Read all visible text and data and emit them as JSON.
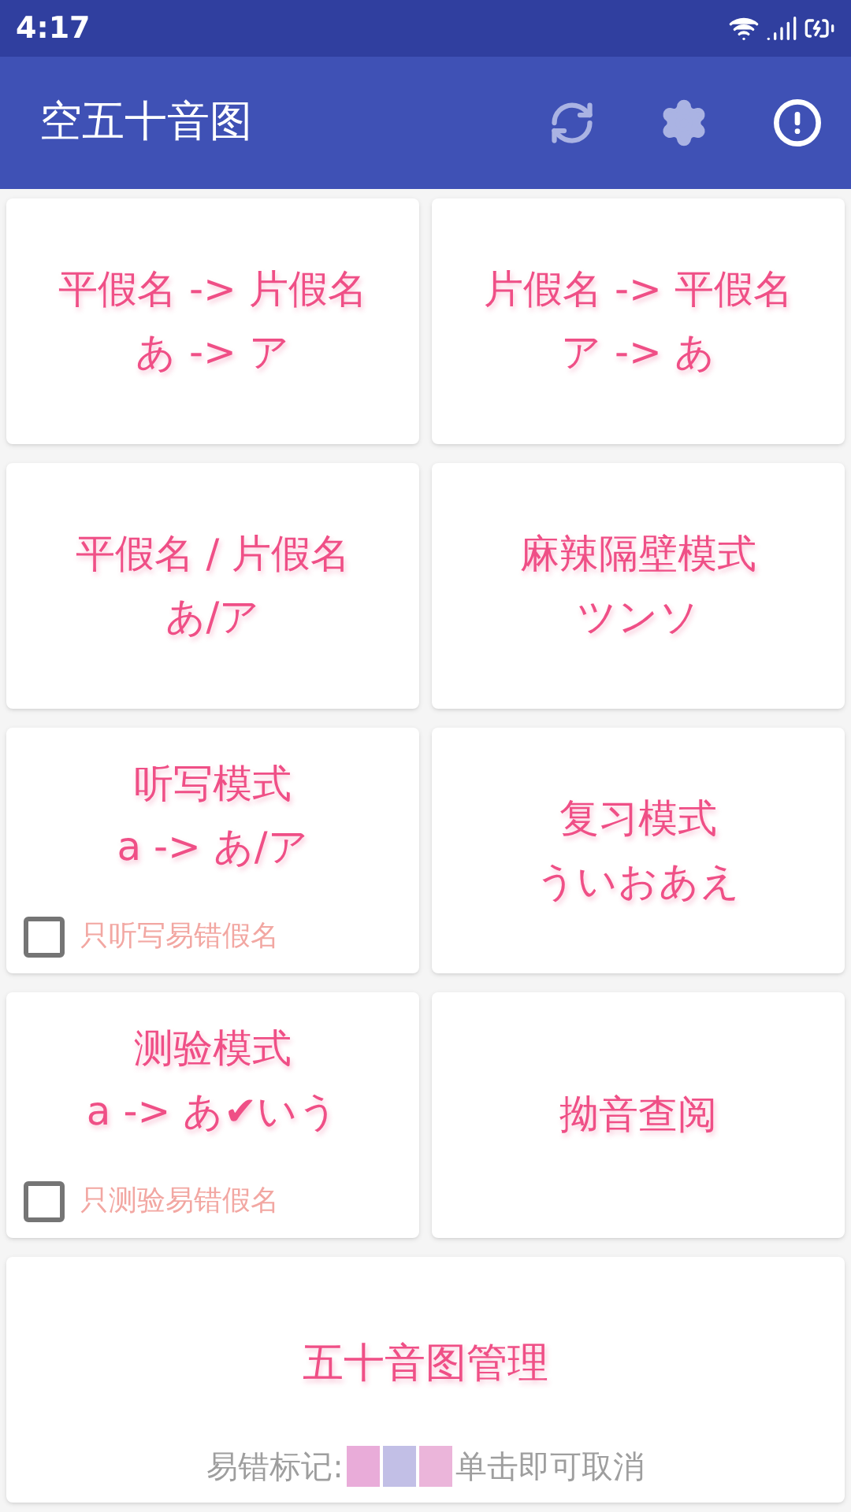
{
  "status_bar": {
    "time": "4:17"
  },
  "app_bar": {
    "title": "空五十音图"
  },
  "cards": [
    {
      "lines": [
        "平假名 -> 片假名",
        "あ -> ア"
      ]
    },
    {
      "lines": [
        "片假名 -> 平假名",
        "ア -> あ"
      ]
    },
    {
      "lines": [
        "平假名 / 片假名",
        "あ/ア"
      ]
    },
    {
      "lines": [
        "麻辣隔壁模式",
        "ツンソ"
      ]
    },
    {
      "lines": [
        "听写模式",
        "a -> あ/ア"
      ],
      "checkbox": {
        "label": "只听写易错假名",
        "checked": false
      }
    },
    {
      "lines": [
        "复习模式",
        "ういおあえ"
      ]
    },
    {
      "lines": [
        "测验模式",
        "a -> あ✔いう"
      ],
      "checkbox": {
        "label": "只测验易错假名",
        "checked": false
      }
    },
    {
      "lines": [
        "拗音查阅"
      ]
    }
  ],
  "manage_card": {
    "title": "五十音图管理",
    "legend_label": "易错标记:",
    "marks": [
      {
        "color": "#e9acd9"
      },
      {
        "color": "#c2bfe6"
      },
      {
        "color": "#ebb5da"
      }
    ],
    "hint": "单击即可取消"
  }
}
